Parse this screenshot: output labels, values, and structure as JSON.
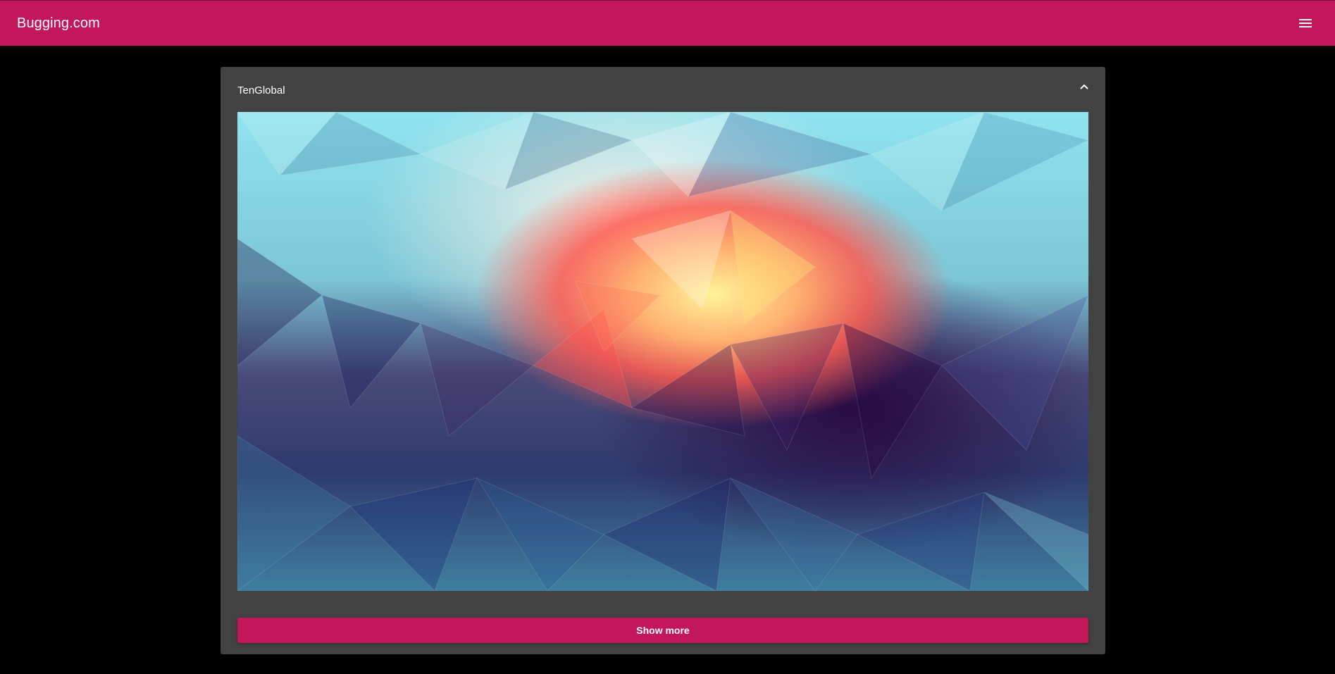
{
  "app": {
    "title": "Bugging.com",
    "brand_color": "#c2185b",
    "menu_icon": "menu-icon"
  },
  "card": {
    "title": "TenGlobal",
    "collapse_icon": "chevron-up-icon",
    "image_description_icon": "low-poly-artwork",
    "show_more_label": "Show more"
  }
}
